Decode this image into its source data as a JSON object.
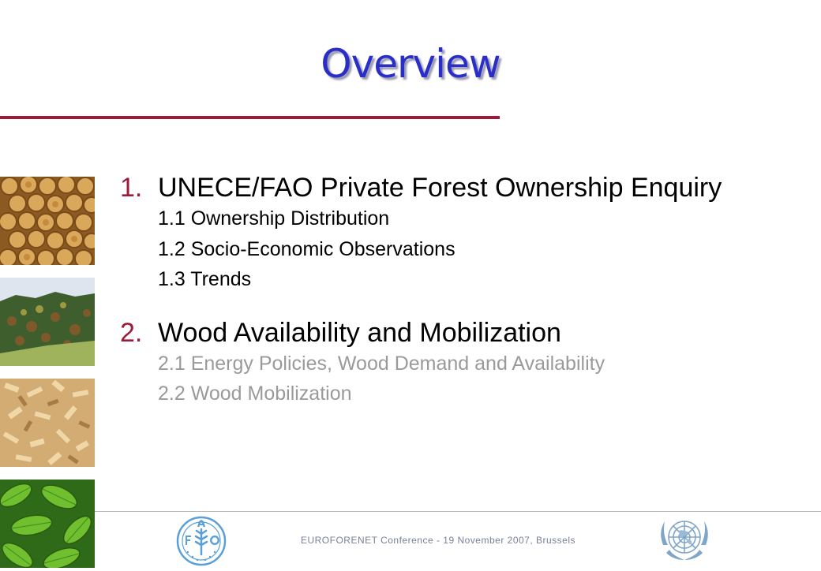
{
  "slide": {
    "title": "Overview",
    "items": [
      {
        "number": "1.",
        "heading": "UNECE/FAO Private Forest Ownership Enquiry",
        "subitems": [
          "1.1 Ownership Distribution",
          "1.2 Socio-Economic Observations",
          "1.3 Trends"
        ]
      },
      {
        "number": "2.",
        "heading": "Wood Availability and Mobilization",
        "subitems": [
          "2.1 Energy Policies, Wood Demand and Availability",
          "2.2 Wood Mobilization"
        ]
      }
    ]
  },
  "footer": {
    "text": "EUROFORENET Conference - 19 November 2007, Brussels"
  },
  "colors": {
    "title": "#2a2ec8",
    "accent": "#9e1a3a",
    "muted_text": "#9a9a9a",
    "footer_text": "#7a7f9a"
  },
  "images": [
    {
      "name": "log-stack-photo"
    },
    {
      "name": "forest-hillside-photo"
    },
    {
      "name": "wood-chips-photo"
    },
    {
      "name": "green-leaves-photo"
    }
  ],
  "logos": [
    "fao-logo",
    "un-emblem"
  ]
}
